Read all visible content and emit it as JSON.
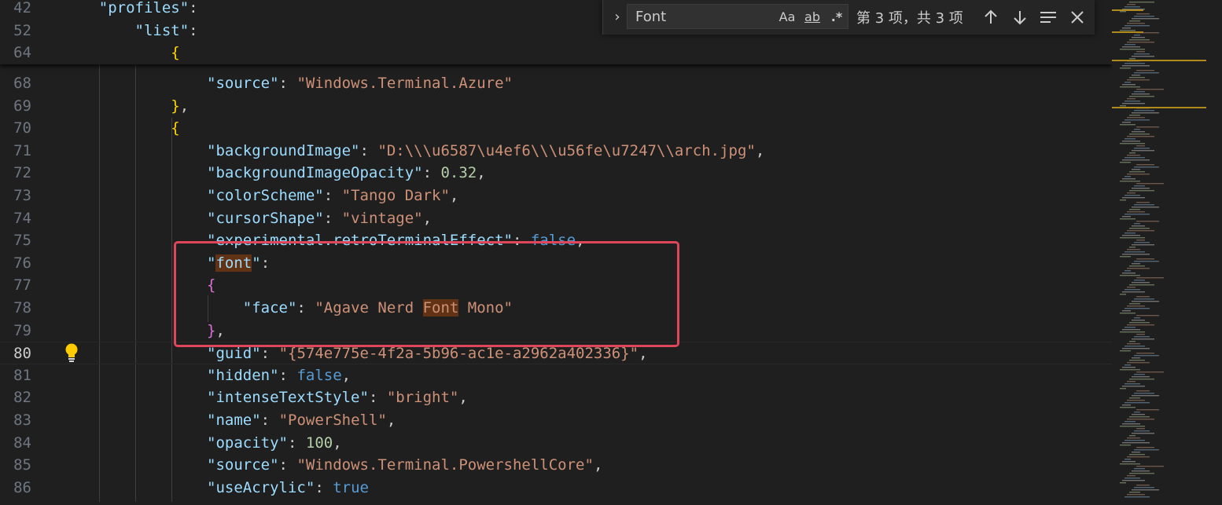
{
  "sticky": [
    {
      "ln": "42",
      "parts": [
        {
          "t": "    ",
          "c": "p"
        },
        {
          "t": "\"profiles\"",
          "c": "k"
        },
        {
          "t": ":",
          "c": "p"
        }
      ]
    },
    {
      "ln": "52",
      "parts": [
        {
          "t": "        ",
          "c": "p"
        },
        {
          "t": "\"list\"",
          "c": "k"
        },
        {
          "t": ":",
          "c": "p"
        }
      ]
    },
    {
      "ln": "64",
      "parts": [
        {
          "t": "            ",
          "c": "p"
        },
        {
          "t": "{",
          "c": "br1"
        }
      ]
    }
  ],
  "lines": [
    {
      "ln": "68",
      "parts": [
        {
          "t": "                ",
          "c": "p"
        },
        {
          "t": "\"source\"",
          "c": "k"
        },
        {
          "t": ": ",
          "c": "p"
        },
        {
          "t": "\"Windows.Terminal.Azure\"",
          "c": "s"
        }
      ]
    },
    {
      "ln": "69",
      "parts": [
        {
          "t": "            ",
          "c": "p"
        },
        {
          "t": "}",
          "c": "br1"
        },
        {
          "t": ",",
          "c": "p"
        }
      ]
    },
    {
      "ln": "70",
      "parts": [
        {
          "t": "            ",
          "c": "p"
        },
        {
          "t": "{",
          "c": "br1"
        }
      ]
    },
    {
      "ln": "71",
      "parts": [
        {
          "t": "                ",
          "c": "p"
        },
        {
          "t": "\"backgroundImage\"",
          "c": "k"
        },
        {
          "t": ": ",
          "c": "p"
        },
        {
          "t": "\"D:\\\\\\u6587\\u4ef6\\\\\\u56fe\\u7247\\\\arch.jpg\"",
          "c": "s"
        },
        {
          "t": ",",
          "c": "p"
        }
      ]
    },
    {
      "ln": "72",
      "parts": [
        {
          "t": "                ",
          "c": "p"
        },
        {
          "t": "\"backgroundImageOpacity\"",
          "c": "k"
        },
        {
          "t": ": ",
          "c": "p"
        },
        {
          "t": "0.32",
          "c": "n"
        },
        {
          "t": ",",
          "c": "p"
        }
      ]
    },
    {
      "ln": "73",
      "parts": [
        {
          "t": "                ",
          "c": "p"
        },
        {
          "t": "\"colorScheme\"",
          "c": "k"
        },
        {
          "t": ": ",
          "c": "p"
        },
        {
          "t": "\"Tango Dark\"",
          "c": "s"
        },
        {
          "t": ",",
          "c": "p"
        }
      ]
    },
    {
      "ln": "74",
      "parts": [
        {
          "t": "                ",
          "c": "p"
        },
        {
          "t": "\"cursorShape\"",
          "c": "k"
        },
        {
          "t": ": ",
          "c": "p"
        },
        {
          "t": "\"vintage\"",
          "c": "s"
        },
        {
          "t": ",",
          "c": "p"
        }
      ]
    },
    {
      "ln": "75",
      "parts": [
        {
          "t": "                ",
          "c": "p"
        },
        {
          "t": "\"experimental.retroTerminalEffect\"",
          "c": "k"
        },
        {
          "t": ": ",
          "c": "p"
        },
        {
          "t": "false",
          "c": "b"
        },
        {
          "t": ",",
          "c": "p"
        }
      ]
    },
    {
      "ln": "76",
      "parts": [
        {
          "t": "                ",
          "c": "p"
        },
        {
          "t": "\"",
          "c": "k"
        },
        {
          "t": "font",
          "c": "k hl"
        },
        {
          "t": "\"",
          "c": "k"
        },
        {
          "t": ":",
          "c": "p"
        }
      ]
    },
    {
      "ln": "77",
      "parts": [
        {
          "t": "                ",
          "c": "p"
        },
        {
          "t": "{",
          "c": "br2"
        }
      ]
    },
    {
      "ln": "78",
      "parts": [
        {
          "t": "                    ",
          "c": "p"
        },
        {
          "t": "\"face\"",
          "c": "k"
        },
        {
          "t": ": ",
          "c": "p"
        },
        {
          "t": "\"Agave Nerd ",
          "c": "s"
        },
        {
          "t": "Font",
          "c": "s hl"
        },
        {
          "t": " Mono\"",
          "c": "s"
        }
      ]
    },
    {
      "ln": "79",
      "parts": [
        {
          "t": "                ",
          "c": "p"
        },
        {
          "t": "}",
          "c": "br2"
        },
        {
          "t": ",",
          "c": "p"
        }
      ]
    },
    {
      "ln": "80",
      "active": true,
      "parts": [
        {
          "t": "                ",
          "c": "p"
        },
        {
          "t": "\"guid\"",
          "c": "k"
        },
        {
          "t": ": ",
          "c": "p"
        },
        {
          "t": "\"{574e775e-4f2a-5b96-ac1e-a2962a402336}\"",
          "c": "s"
        },
        {
          "t": ",",
          "c": "p"
        }
      ]
    },
    {
      "ln": "81",
      "parts": [
        {
          "t": "                ",
          "c": "p"
        },
        {
          "t": "\"hidden\"",
          "c": "k"
        },
        {
          "t": ": ",
          "c": "p"
        },
        {
          "t": "false",
          "c": "b"
        },
        {
          "t": ",",
          "c": "p"
        }
      ]
    },
    {
      "ln": "82",
      "parts": [
        {
          "t": "                ",
          "c": "p"
        },
        {
          "t": "\"intenseTextStyle\"",
          "c": "k"
        },
        {
          "t": ": ",
          "c": "p"
        },
        {
          "t": "\"bright\"",
          "c": "s"
        },
        {
          "t": ",",
          "c": "p"
        }
      ]
    },
    {
      "ln": "83",
      "parts": [
        {
          "t": "                ",
          "c": "p"
        },
        {
          "t": "\"name\"",
          "c": "k"
        },
        {
          "t": ": ",
          "c": "p"
        },
        {
          "t": "\"PowerShell\"",
          "c": "s"
        },
        {
          "t": ",",
          "c": "p"
        }
      ]
    },
    {
      "ln": "84",
      "parts": [
        {
          "t": "                ",
          "c": "p"
        },
        {
          "t": "\"opacity\"",
          "c": "k"
        },
        {
          "t": ": ",
          "c": "p"
        },
        {
          "t": "100",
          "c": "n"
        },
        {
          "t": ",",
          "c": "p"
        }
      ]
    },
    {
      "ln": "85",
      "parts": [
        {
          "t": "                ",
          "c": "p"
        },
        {
          "t": "\"source\"",
          "c": "k"
        },
        {
          "t": ": ",
          "c": "p"
        },
        {
          "t": "\"Windows.Terminal.PowershellCore\"",
          "c": "s"
        },
        {
          "t": ",",
          "c": "p"
        }
      ]
    },
    {
      "ln": "86",
      "parts": [
        {
          "t": "                ",
          "c": "p"
        },
        {
          "t": "\"useAcrylic\"",
          "c": "k"
        },
        {
          "t": ": ",
          "c": "p"
        },
        {
          "t": "true",
          "c": "b"
        }
      ]
    }
  ],
  "find": {
    "toggle_icon": "chevron-right-icon",
    "value": "Font",
    "match_case": "Aa",
    "whole_word": "ab",
    "regex": ".*",
    "count": "第 3 项，共 3 项",
    "prev_icon": "arrow-up-icon",
    "next_icon": "arrow-down-icon",
    "selection_icon": "find-in-selection-icon",
    "close_icon": "close-icon"
  },
  "colors": {
    "background": "#1f1f1f",
    "key": "#9cdcfe",
    "string": "#ce9178",
    "number": "#b5cea8",
    "keyword": "#569cd6",
    "bracket_gold": "#ffd700",
    "bracket_pink": "#da70d6",
    "find_highlight": "#613214",
    "annotation_box": "#e0465a"
  }
}
